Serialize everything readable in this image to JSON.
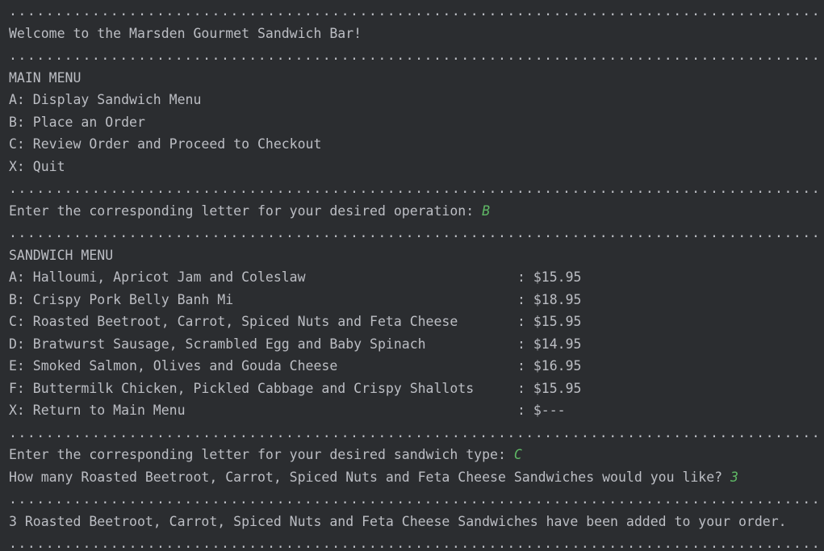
{
  "console": {
    "separator": "....................................................................................................",
    "welcome": "Welcome to the Marsden Gourmet Sandwich Bar!",
    "main_menu": {
      "title": "MAIN MENU",
      "options": [
        "A: Display Sandwich Menu",
        "B: Place an Order",
        "C: Review Order and Proceed to Checkout",
        "X: Quit"
      ]
    },
    "operation_prompt": {
      "text": "Enter the corresponding letter for your desired operation: ",
      "input": "B"
    },
    "sandwich_menu": {
      "title": "SANDWICH MENU",
      "items": [
        {
          "label": "A: Halloumi, Apricot Jam and Coleslaw",
          "price": ": $15.95"
        },
        {
          "label": "B: Crispy Pork Belly Banh Mi",
          "price": ": $18.95"
        },
        {
          "label": "C: Roasted Beetroot, Carrot, Spiced Nuts and Feta Cheese",
          "price": ": $15.95"
        },
        {
          "label": "D: Bratwurst Sausage, Scrambled Egg and Baby Spinach",
          "price": ": $14.95"
        },
        {
          "label": "E: Smoked Salmon, Olives and Gouda Cheese",
          "price": ": $16.95"
        },
        {
          "label": "F: Buttermilk Chicken, Pickled Cabbage and Crispy Shallots",
          "price": ": $15.95"
        },
        {
          "label": "X: Return to Main Menu",
          "price": ": $---"
        }
      ]
    },
    "sandwich_prompt": {
      "text": "Enter the corresponding letter for your desired sandwich type: ",
      "input": "C"
    },
    "quantity_prompt": {
      "text": "How many Roasted Beetroot, Carrot, Spiced Nuts and Feta Cheese Sandwiches would you like? ",
      "input": "3"
    },
    "confirmation": "3 Roasted Beetroot, Carrot, Spiced Nuts and Feta Cheese Sandwiches have been added to your order."
  }
}
